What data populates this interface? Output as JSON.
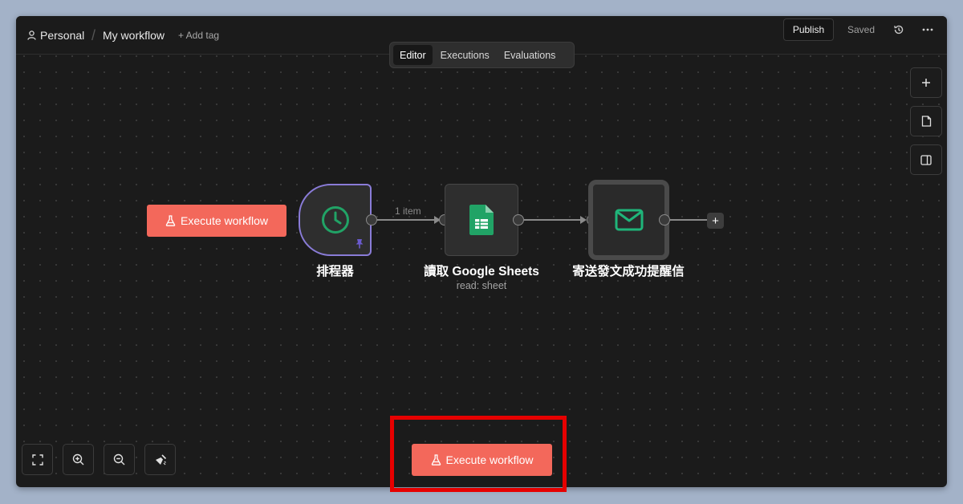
{
  "breadcrumb": {
    "project": "Personal",
    "separator": "/",
    "workflow": "My workflow",
    "add_tag": "+ Add tag"
  },
  "header": {
    "publish": "Publish",
    "saved": "Saved"
  },
  "tabs": [
    {
      "label": "Editor",
      "active": true
    },
    {
      "label": "Executions",
      "active": false
    },
    {
      "label": "Evaluations",
      "active": false
    }
  ],
  "nodes": {
    "trigger": {
      "label": "排程器",
      "icon": "clock-icon",
      "pinned": true
    },
    "sheets": {
      "label": "讀取 Google Sheets",
      "subtitle": "read: sheet",
      "icon": "google-sheets-icon"
    },
    "email": {
      "label": "寄送發文成功提醒信",
      "icon": "mail-icon"
    }
  },
  "edge": {
    "label": "1 item"
  },
  "execute": {
    "label": "Execute workflow"
  },
  "colors": {
    "accent": "#f3685b",
    "trigger_border": "#8a7cd8",
    "sheets_green": "#21a366",
    "mail_green": "#1fb57a",
    "highlight": "#e60000"
  }
}
